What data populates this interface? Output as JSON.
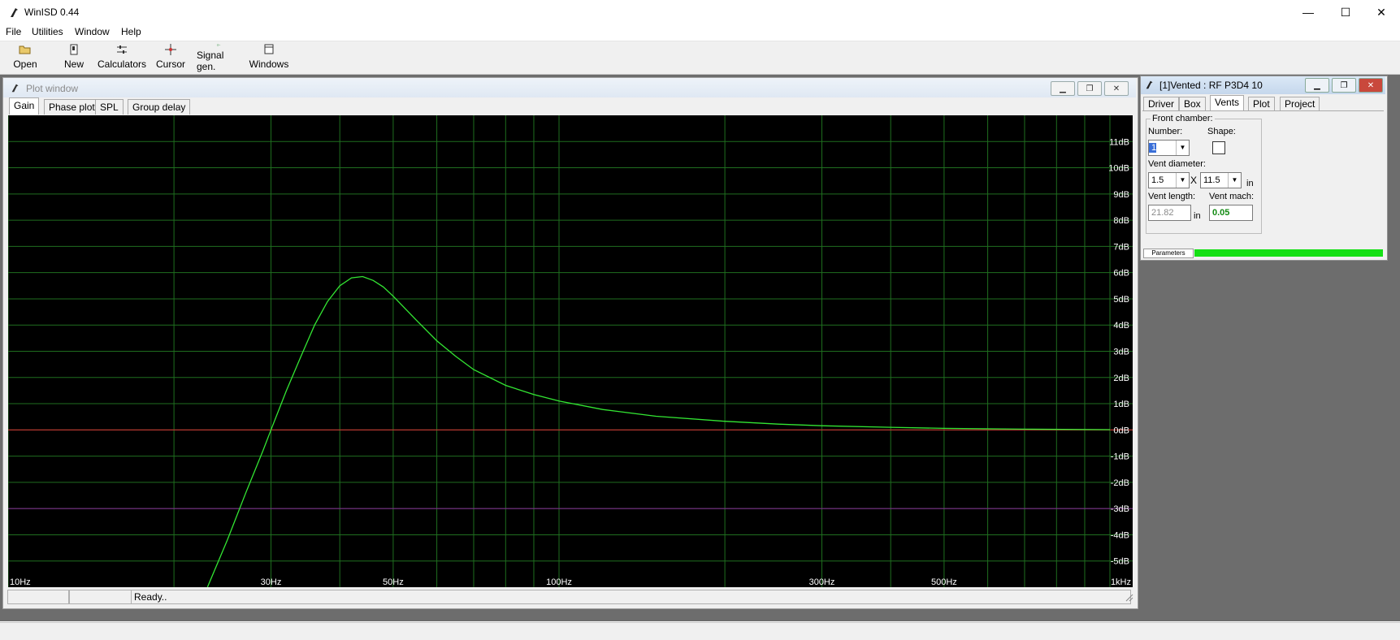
{
  "app": {
    "title": "WinISD 0.44"
  },
  "window_controls": {
    "minimize": "—",
    "maximize": "☐",
    "close": "✕"
  },
  "menu": [
    "File",
    "Utilities",
    "Window",
    "Help"
  ],
  "toolbar": [
    {
      "label": "Open",
      "icon": "folder-open-icon"
    },
    {
      "label": "New",
      "icon": "new-project-icon"
    },
    {
      "label": "Calculators",
      "icon": "calculator-icon"
    },
    {
      "label": "Cursor",
      "icon": "cursor-icon"
    },
    {
      "label": "Signal gen.",
      "icon": "signal-generator-icon"
    },
    {
      "label": "Windows",
      "icon": "windows-icon"
    }
  ],
  "plot_window": {
    "title": "Plot window",
    "tabs": [
      "Gain",
      "Phase plot",
      "SPL",
      "Group delay"
    ],
    "selected_tab": "Gain",
    "status": {
      "box1": "",
      "box2": "",
      "message": "Ready.."
    }
  },
  "chart_data": {
    "type": "line",
    "title": "",
    "xlabel": "",
    "ylabel": "",
    "x_scale": "log",
    "xlim": [
      10,
      1000
    ],
    "ylim": [
      -6,
      12
    ],
    "grid": true,
    "x_tick_labels": [
      {
        "value": 10,
        "label": "10Hz"
      },
      {
        "value": 30,
        "label": "30Hz"
      },
      {
        "value": 50,
        "label": "50Hz"
      },
      {
        "value": 100,
        "label": "100Hz"
      },
      {
        "value": 300,
        "label": "300Hz"
      },
      {
        "value": 500,
        "label": "500Hz"
      },
      {
        "value": 1000,
        "label": "1kHz"
      }
    ],
    "y_tick_labels": [
      {
        "value": 11,
        "label": "11dB"
      },
      {
        "value": 10,
        "label": "10dB"
      },
      {
        "value": 9,
        "label": "9dB"
      },
      {
        "value": 8,
        "label": "8dB"
      },
      {
        "value": 7,
        "label": "7dB"
      },
      {
        "value": 6,
        "label": "6dB"
      },
      {
        "value": 5,
        "label": "5dB"
      },
      {
        "value": 4,
        "label": "4dB"
      },
      {
        "value": 3,
        "label": "3dB"
      },
      {
        "value": 2,
        "label": "2dB"
      },
      {
        "value": 1,
        "label": "1dB"
      },
      {
        "value": 0,
        "label": "0dB"
      },
      {
        "value": -1,
        "label": "-1dB"
      },
      {
        "value": -2,
        "label": "-2dB"
      },
      {
        "value": -3,
        "label": "-3dB"
      },
      {
        "value": -4,
        "label": "-4dB"
      },
      {
        "value": -5,
        "label": "-5dB"
      }
    ],
    "reference_lines": [
      {
        "y": 0,
        "color": "#c83232"
      },
      {
        "y": -3,
        "color": "#7a2a8a"
      }
    ],
    "series": [
      {
        "color": "#33e633",
        "points": [
          [
            23,
            -6.0
          ],
          [
            25,
            -4.2
          ],
          [
            27,
            -2.4
          ],
          [
            29,
            -0.8
          ],
          [
            30,
            0.0
          ],
          [
            32,
            1.5
          ],
          [
            34,
            2.8
          ],
          [
            36,
            4.0
          ],
          [
            38,
            4.9
          ],
          [
            40,
            5.5
          ],
          [
            42,
            5.8
          ],
          [
            44,
            5.85
          ],
          [
            46,
            5.7
          ],
          [
            48,
            5.45
          ],
          [
            50,
            5.1
          ],
          [
            55,
            4.2
          ],
          [
            60,
            3.4
          ],
          [
            65,
            2.8
          ],
          [
            70,
            2.3
          ],
          [
            80,
            1.7
          ],
          [
            90,
            1.35
          ],
          [
            100,
            1.1
          ],
          [
            120,
            0.78
          ],
          [
            150,
            0.52
          ],
          [
            200,
            0.33
          ],
          [
            250,
            0.22
          ],
          [
            300,
            0.16
          ],
          [
            400,
            0.1
          ],
          [
            500,
            0.06
          ],
          [
            700,
            0.03
          ],
          [
            1000,
            0.01
          ]
        ]
      }
    ]
  },
  "right_window": {
    "title": "[1]Vented : RF P3D4 10",
    "tabs": [
      "Driver",
      "Box",
      "Vents",
      "Plot",
      "Project"
    ],
    "selected_tab": "Vents",
    "front_chamber": {
      "legend": "Front chamber:",
      "number_label": "Number:",
      "number_value": "1",
      "shape_label": "Shape:",
      "vent_diameter_label": "Vent diameter:",
      "diameter_1": "1.5",
      "x_sep": "X",
      "diameter_2": "11.5",
      "diameter_unit": "in",
      "vent_length_label": "Vent length:",
      "vent_length_value": "21.82",
      "vent_length_unit": "in",
      "vent_mach_label": "Vent mach:",
      "vent_mach_value": "0.05"
    },
    "params_label": "Parameters"
  }
}
